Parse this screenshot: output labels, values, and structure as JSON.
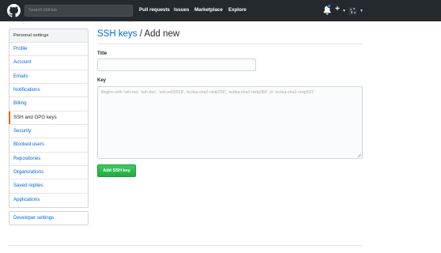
{
  "header": {
    "search_placeholder": "Search GitHub",
    "nav": [
      "Pull requests",
      "Issues",
      "Marketplace",
      "Explore"
    ],
    "plus_label": "+",
    "icons": [
      "github-logo-icon",
      "bell-icon",
      "plus-icon",
      "avatar-icon"
    ]
  },
  "sidebar": {
    "heading": "Personal settings",
    "items": [
      {
        "label": "Profile"
      },
      {
        "label": "Account"
      },
      {
        "label": "Emails"
      },
      {
        "label": "Notifications"
      },
      {
        "label": "Billing"
      },
      {
        "label": "SSH and GPG keys"
      },
      {
        "label": "Security"
      },
      {
        "label": "Blocked users"
      },
      {
        "label": "Repositories"
      },
      {
        "label": "Organizations"
      },
      {
        "label": "Saved replies"
      },
      {
        "label": "Applications"
      }
    ],
    "selected": "SSH and GPG keys",
    "developer_settings": "Developer settings"
  },
  "main": {
    "breadcrumb": "SSH keys",
    "separator": "/",
    "title": "Add new",
    "title_label": "Title",
    "title_value": "",
    "key_label": "Key",
    "key_placeholder": "Begins with 'ssh-rsa', 'ssh-dss', 'ssh-ed25519', 'ecdsa-sha2-nistp256', 'ecdsa-sha2-nistp384', or 'ecdsa-sha2-nistp521'",
    "submit_label": "Add SSH key"
  },
  "colors": {
    "header_bg": "#24292e",
    "link": "#0366d6",
    "selected_marker": "#e36209",
    "button_green": "#28a745"
  }
}
